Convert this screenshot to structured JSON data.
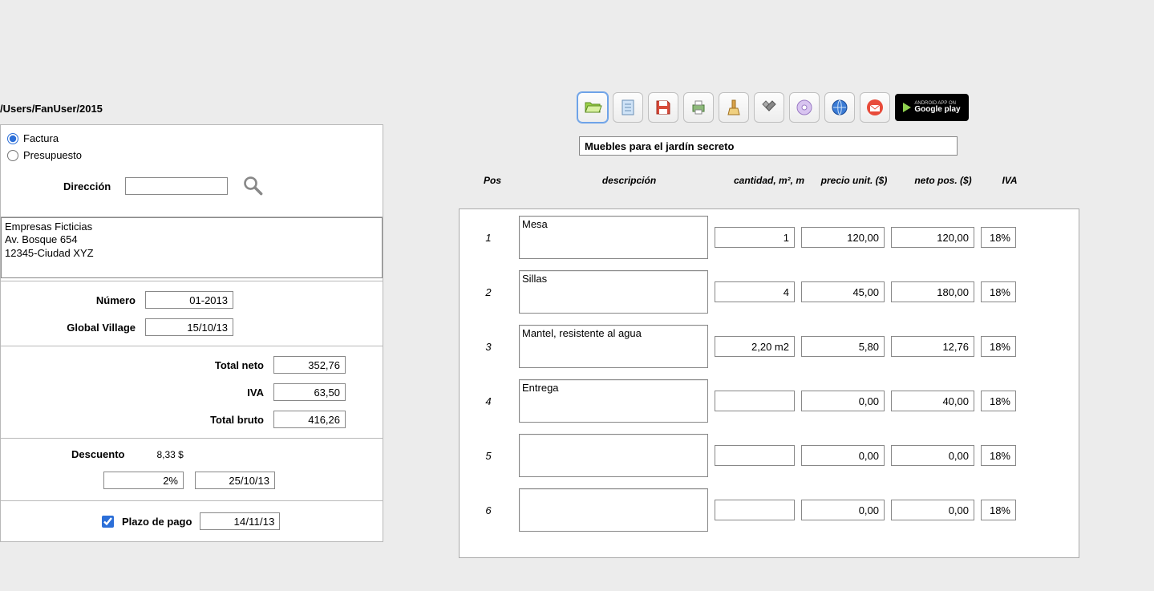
{
  "path": "/Users/FanUser/2015",
  "doc_type": {
    "factura_label": "Factura",
    "presupuesto_label": "Presupuesto",
    "selected": "factura"
  },
  "direccion_label": "Dirección",
  "direccion_value": "",
  "address_text": "Empresas Ficticias\nAv. Bosque 654\n12345-Ciudad XYZ",
  "numero_label": "Número",
  "numero_value": "01-2013",
  "location_label": "Global Village",
  "location_value": "15/10/13",
  "totals": {
    "neto_label": "Total neto",
    "neto_value": "352,76",
    "iva_label": "IVA",
    "iva_value": "63,50",
    "bruto_label": "Total bruto",
    "bruto_value": "416,26"
  },
  "discount": {
    "label": "Descuento",
    "amount": "8,33 $",
    "percent": "2%",
    "date": "25/10/13"
  },
  "plazo": {
    "label": "Plazo de pago",
    "checked": true,
    "date": "14/11/13"
  },
  "toolbar_icons": [
    {
      "name": "open-folder-icon",
      "selected": true
    },
    {
      "name": "document-icon",
      "selected": false
    },
    {
      "name": "save-icon",
      "selected": false
    },
    {
      "name": "print-icon",
      "selected": false
    },
    {
      "name": "clean-brush-icon",
      "selected": false
    },
    {
      "name": "settings-icon",
      "selected": false
    },
    {
      "name": "disc-icon",
      "selected": false
    },
    {
      "name": "globe-icon",
      "selected": false
    },
    {
      "name": "mail-icon",
      "selected": false
    }
  ],
  "gplay": {
    "small": "ANDROID APP ON",
    "big": "Google play"
  },
  "title_value": "Muebles para el jardín secreto",
  "columns": {
    "pos": "Pos",
    "desc": "descripción",
    "cant": "cantidad, m², m",
    "pu": "precio unit. ($)",
    "net": "neto pos. ($)",
    "iva": "IVA"
  },
  "items": [
    {
      "pos": "1",
      "desc": "Mesa",
      "cant": "1",
      "pu": "120,00",
      "net": "120,00",
      "iva": "18%"
    },
    {
      "pos": "2",
      "desc": "Sillas",
      "cant": "4",
      "pu": "45,00",
      "net": "180,00",
      "iva": "18%"
    },
    {
      "pos": "3",
      "desc": "Mantel, resistente al agua",
      "cant": "2,20 m2",
      "pu": "5,80",
      "net": "12,76",
      "iva": "18%"
    },
    {
      "pos": "4",
      "desc": "Entrega",
      "cant": "",
      "pu": "0,00",
      "net": "40,00",
      "iva": "18%"
    },
    {
      "pos": "5",
      "desc": "",
      "cant": "",
      "pu": "0,00",
      "net": "0,00",
      "iva": "18%"
    },
    {
      "pos": "6",
      "desc": "",
      "cant": "",
      "pu": "0,00",
      "net": "0,00",
      "iva": "18%"
    }
  ]
}
